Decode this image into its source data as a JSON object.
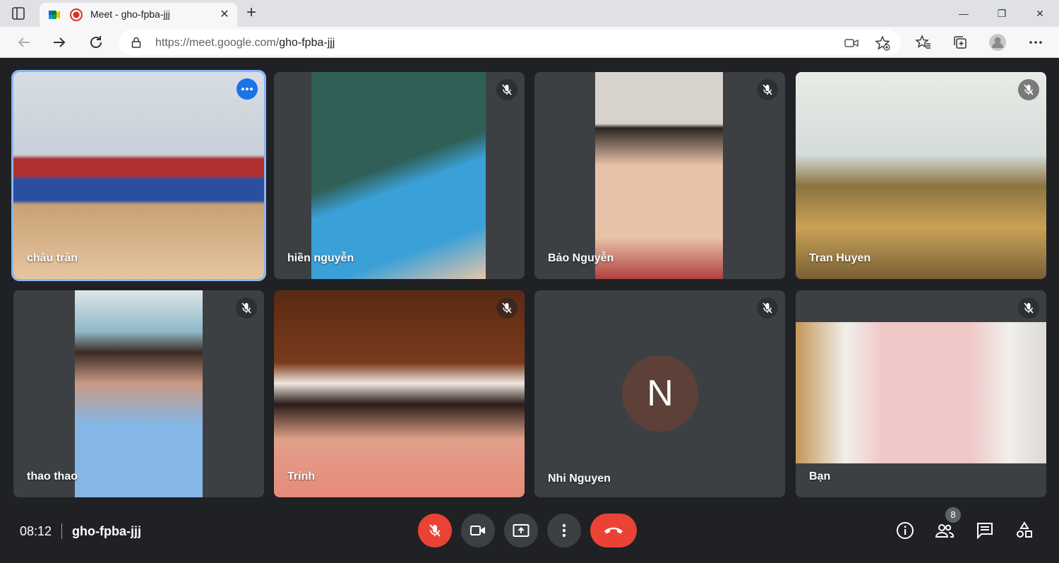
{
  "browser": {
    "tab_title": "Meet - gho-fpba-jjj",
    "tab_close": "✕",
    "new_tab": "+",
    "url_host": "https://meet.google.com/",
    "url_path": "gho-fpba-jjj",
    "window_controls": {
      "minimize": "—",
      "restore": "❐",
      "close": "✕"
    }
  },
  "participants": [
    {
      "name": "châu trần",
      "active": true,
      "muted": false,
      "video_colors": [
        "#d8dde5",
        "#b03030",
        "#2a4fa0"
      ]
    },
    {
      "name": "hiền nguyễn",
      "muted": true,
      "video_colors": [
        "#2f5f57",
        "#3aa0d8",
        "#e6c5a8"
      ]
    },
    {
      "name": "Bảo Nguyễn",
      "muted": true,
      "video_colors": [
        "#d8d2cc",
        "#2a2522",
        "#e8c2a8"
      ]
    },
    {
      "name": "Tran Huyen",
      "muted": true,
      "video_colors": [
        "#e8ebe6",
        "#8b7340",
        "#c9a256"
      ]
    },
    {
      "name": "thao thao",
      "muted": true,
      "video_colors": [
        "#8fb8c8",
        "#86b6e6",
        "#3a2a24"
      ]
    },
    {
      "name": "Trinh",
      "muted": true,
      "video_colors": [
        "#5a2a14",
        "#f0e6de",
        "#e0a08a"
      ]
    },
    {
      "name": "Nhi Nguyen",
      "muted": true,
      "avatar_letter": "N",
      "avatar_color": "#5d4037"
    },
    {
      "name": "Bạn",
      "muted": true,
      "video_colors": [
        "#f1efeb",
        "#c49658",
        "#f0c8c8"
      ]
    }
  ],
  "meeting": {
    "time": "08:12",
    "code": "gho-fpba-jjj",
    "participant_count": "8"
  },
  "colors": {
    "background": "#202124",
    "tile": "#3c4043",
    "hangup": "#ea4335",
    "active_outline": "#8ab4f8"
  }
}
